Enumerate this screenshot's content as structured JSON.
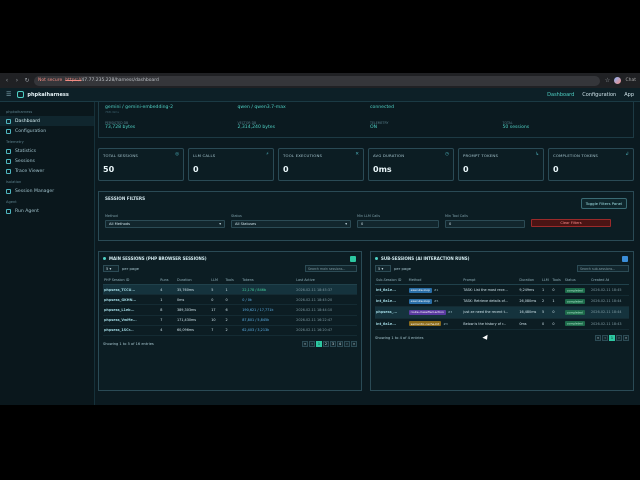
{
  "browser": {
    "insecure_label": "Not secure",
    "url_proto": "https://",
    "url_rest": "47.77.235.228/harness/dashboard",
    "profile": "Chat"
  },
  "app": {
    "title": "phpkaiharness",
    "nav_dashboard": "Dashboard",
    "nav_configuration": "Configuration",
    "nav_app": "App"
  },
  "sidebar": {
    "section_main": "phpkaiharness",
    "items_main": [
      {
        "label": "Dashboard",
        "icon": "dashboard-icon"
      },
      {
        "label": "Configuration",
        "icon": "gear-icon"
      }
    ],
    "section_telemetry": "Telemetry",
    "items_telemetry": [
      {
        "label": "Statistics",
        "icon": "chart-icon"
      },
      {
        "label": "Sessions",
        "icon": "list-icon"
      },
      {
        "label": "Trace Viewer",
        "icon": "trace-icon"
      }
    ],
    "section_isolation": "Isolation",
    "items_isolation": [
      {
        "label": "Session Manager",
        "icon": "server-icon"
      }
    ],
    "section_agent": "Agent",
    "items_agent": [
      {
        "label": "Run Agent",
        "icon": "play-icon"
      }
    ]
  },
  "info": {
    "model_a": "gemini / gemini-embedding-2",
    "model_a_sub": "768 dims",
    "model_b": "qwen / qwen3.7-max",
    "model_c": "connected",
    "size_a_label": "PERSISTED DB",
    "size_a": "73,728 bytes",
    "size_b_label": "VECTOR DB",
    "size_b": "2,314,240 bytes",
    "telemetry_label": "TELEMETRY",
    "telemetry": "ON",
    "count_label": "TOTAL",
    "count": "50 sessions"
  },
  "stats": [
    {
      "label": "TOTAL SESSIONS",
      "value": "50",
      "icon": "sessions-icon"
    },
    {
      "label": "LLM CALLS",
      "value": "0",
      "icon": "llm-icon"
    },
    {
      "label": "TOOL EXECUTIONS",
      "value": "0",
      "icon": "tools-icon"
    },
    {
      "label": "AVG DURATION",
      "value": "0ms",
      "icon": "clock-icon"
    },
    {
      "label": "PROMPT TOKENS",
      "value": "0",
      "icon": "prompt-icon"
    },
    {
      "label": "COMPLETION TOKENS",
      "value": "0",
      "icon": "completion-icon"
    }
  ],
  "filters": {
    "title": "SESSION FILTERS",
    "toggle": "Toggle Filters Panel",
    "method_label": "Method",
    "method_value": "All Methods",
    "status_label": "Status",
    "status_value": "All Statuses",
    "min_llm_label": "Min LLM Calls",
    "min_llm_value": "0",
    "min_tool_label": "Min Tool Calls",
    "min_tool_value": "0",
    "clear": "Clear Filters"
  },
  "main_sessions": {
    "title": "MAIN SESSIONS (PHP BROWSER SESSIONS)",
    "per_page_value": "5",
    "per_page_label": "per page",
    "search_placeholder": "Search main sessions...",
    "headers": [
      "PHP Session ID",
      "Runs",
      "Duration",
      "LLM",
      "Tools",
      "Tokens",
      "Last Active"
    ],
    "rows": [
      [
        "phpsess_TCCU...",
        "4",
        "35,760ms",
        "5",
        "1",
        "22,178 / 846b",
        "2026-02-11 18:45:37"
      ],
      [
        "phpsess_GKHN...",
        "1",
        "0ms",
        "0",
        "0",
        "0 / 0k",
        "2026-02-11 18:45:20"
      ],
      [
        "phpsess_L1eb...",
        "8",
        "389,303ms",
        "17",
        "6",
        "190,621 / 17,771k",
        "2026-02-11 18:44:10"
      ],
      [
        "phpsess_VwMe...",
        "7",
        "171,430ms",
        "10",
        "2",
        "87,801 / 5,845k",
        "2026-02-11 16:22:47"
      ],
      [
        "phpsess_1SCr...",
        "4",
        "60,096ms",
        "7",
        "2",
        "62,403 / 3,213k",
        "2026-02-11 16:20:47"
      ]
    ],
    "showing": "Showing 1 to 5 of 16 entries",
    "pages": [
      "«",
      "‹",
      "1",
      "2",
      "3",
      "4",
      "›",
      "»"
    ],
    "active_page": "1"
  },
  "sub_sessions": {
    "title": "SUB-SESSIONS (AI INTERACTION RUNS)",
    "per_page_value": "5",
    "per_page_label": "per page",
    "search_placeholder": "Search sub-sessions...",
    "headers": [
      "Sub-Session ID",
      "Method",
      "Prompt",
      "Duration",
      "LLM",
      "Tools",
      "Status",
      "Created At"
    ],
    "rows": [
      {
        "id": "int_6a1e...",
        "method": "execute-loop",
        "method_n": "#1",
        "pill": "exec",
        "prompt": "TASK: List the most rece...",
        "duration": "9,249ms",
        "llm": "1",
        "tools": "0",
        "status": "completed",
        "created": "2026-02-11 18:45"
      },
      {
        "id": "int_6a1e...",
        "method": "execute-loop",
        "method_n": "#5",
        "pill": "exec",
        "prompt": "TASK: Retrieve details of...",
        "duration": "26,080ms",
        "llm": "2",
        "tools": "1",
        "status": "completed",
        "created": "2026-02-11 18:44"
      },
      {
        "id": "phpsess_...",
        "method": "route-classified-action",
        "method_n": "#3",
        "pill": "route",
        "prompt": "just ze need the recent t...",
        "duration": "16,480ms",
        "llm": "5",
        "tools": "0",
        "status": "completed",
        "created": "2026-02-11 18:44"
      },
      {
        "id": "int_6a1e...",
        "method": "semantic-cache-hit",
        "method_n": "#3",
        "pill": "sem",
        "prompt": "Below is the history of r...",
        "duration": "0ms",
        "llm": "0",
        "tools": "0",
        "status": "completed",
        "created": "2026-02-11 18:43"
      }
    ],
    "showing": "Showing 1 to 4 of 4 entries",
    "pages": [
      "«",
      "‹",
      "1",
      "›",
      "»"
    ],
    "active_page": "1"
  }
}
